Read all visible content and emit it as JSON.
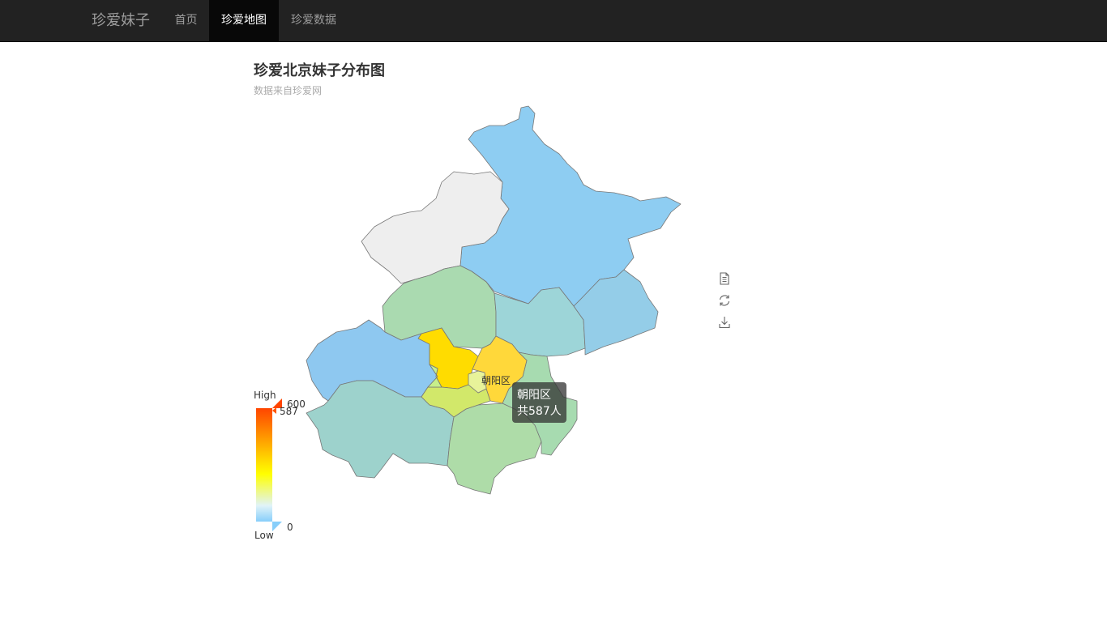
{
  "nav": {
    "brand": "珍爱妹子",
    "items": [
      "首页",
      "珍爱地图",
      "珍爱数据"
    ],
    "active_index": 1
  },
  "chart": {
    "title": "珍爱北京妹子分布图",
    "subtitle": "数据来自珍爱网"
  },
  "map": {
    "highlighted_label": "朝阳区",
    "colors": {
      "north": "#8ecdf2",
      "yanqing": "#eeeeee",
      "changping": "#aadab0",
      "shunyi": "#9dd5d8",
      "pinggu": "#94cde8",
      "mentougou": "#8ec8f0",
      "fangshan": "#9dd2cc",
      "daxing": "#aedca8",
      "tongzhou": "#a7dbb0",
      "haidian": "#ffdc00",
      "chaoyang": "#ffd83a",
      "fengtai": "#d2e86a",
      "shijingshan": "#c7ef8a",
      "core": "#e8f39a"
    }
  },
  "tooltip": {
    "name": "朝阳区",
    "value": "共587人"
  },
  "visual_map": {
    "high_label": "High",
    "low_label": "Low",
    "max": "600",
    "min": "0",
    "current": "587",
    "current_value": 587,
    "max_value": 600,
    "min_value": 0
  },
  "toolbox": [
    "data-view-icon",
    "restore-icon",
    "save-image-icon"
  ]
}
